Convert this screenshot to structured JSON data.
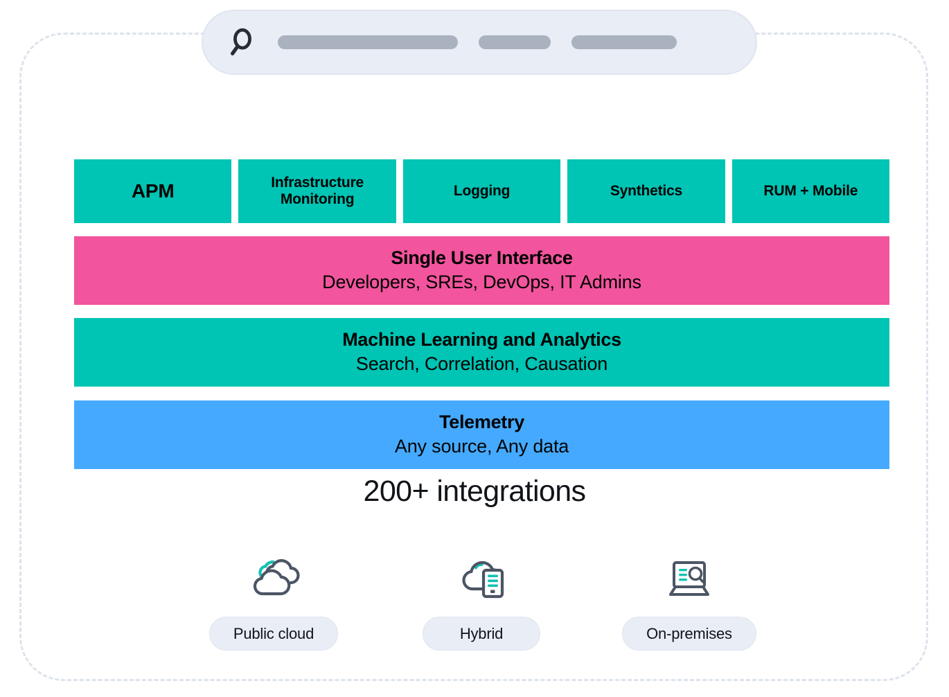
{
  "search": {
    "icon": "search-icon",
    "placeholder_pills": [
      260,
      104,
      152
    ]
  },
  "tiers": {
    "products": [
      {
        "label": "APM"
      },
      {
        "label": "Infrastructure\nMonitoring"
      },
      {
        "label": "Logging"
      },
      {
        "label": "Synthetics"
      },
      {
        "label": "RUM + Mobile"
      }
    ],
    "bands": [
      {
        "title": "Single User Interface",
        "subtitle": "Developers, SREs, DevOps, IT Admins",
        "color": "#f2549d"
      },
      {
        "title": "Machine Learning and Analytics",
        "subtitle": "Search, Correlation, Causation",
        "color": "#00c4b4"
      },
      {
        "title": "Telemetry",
        "subtitle": "Any source, Any data",
        "color": "#45aaff"
      }
    ]
  },
  "integrations_caption": "200+ integrations",
  "deployments": [
    {
      "label": "Public cloud",
      "icon": "clouds-icon"
    },
    {
      "label": "Hybrid",
      "icon": "cloud-server-icon"
    },
    {
      "label": "On-premises",
      "icon": "laptop-search-icon"
    }
  ],
  "colors": {
    "teal": "#00c4b4",
    "pink": "#f2549d",
    "blue": "#45aaff",
    "icon_gray": "#4c5565",
    "icon_teal": "#12c2b4",
    "chip_bg": "#e9edf5",
    "dashed_border": "#dde3ec"
  }
}
